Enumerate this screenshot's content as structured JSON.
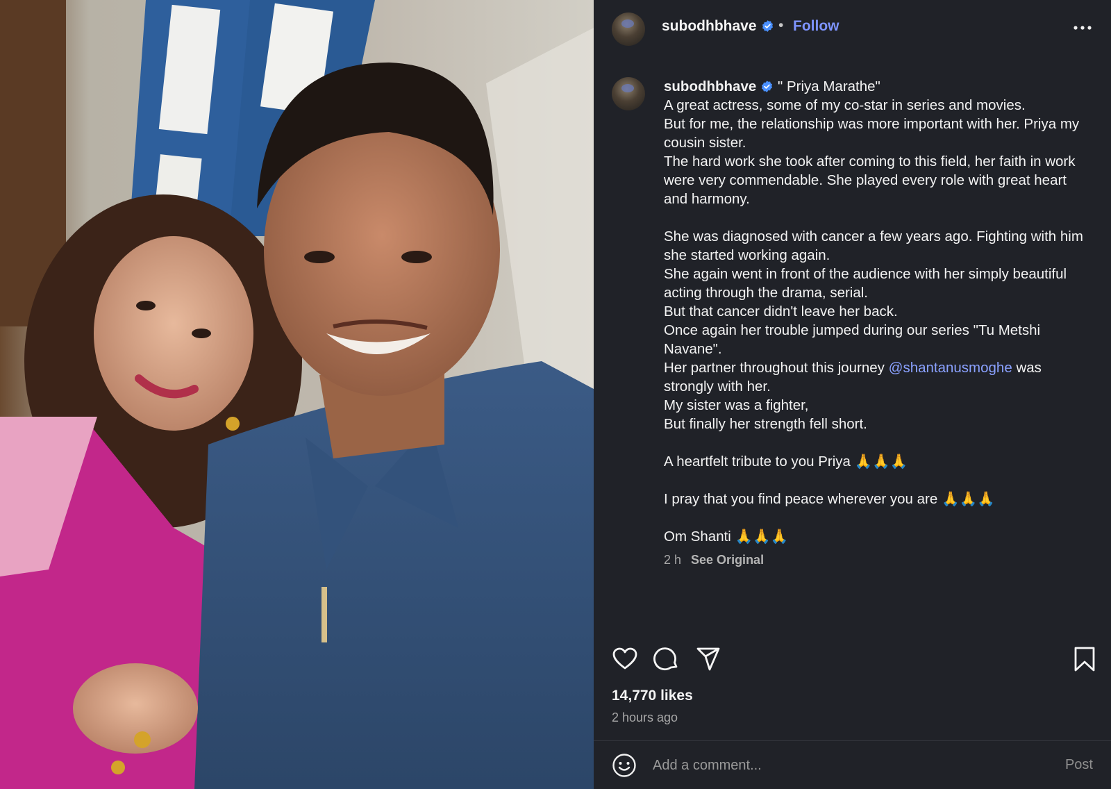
{
  "post": {
    "username": "subodhbhave",
    "verified": true,
    "follow_label": "Follow",
    "separator": "•",
    "more_icon": "more-horizontal-icon"
  },
  "caption": {
    "username": "subodhbhave",
    "lines": [
      "\" Priya Marathe\"",
      "A great actress, some of my co-star in series and movies.",
      "But for me, the relationship was more important with her. Priya my cousin sister.",
      "The hard work she took after coming to this field, her faith in work were very commendable. She played every role with great heart and harmony.",
      "",
      "She was diagnosed with cancer a few years ago. Fighting with him she started working again.",
      "She again went in front of the audience with her simply beautiful acting through the drama, serial.",
      "But that cancer didn't leave her back.",
      "Once again her trouble jumped during our series \"Tu Metshi Navane\".",
      "Her partner throughout this journey",
      "@shantanusmoghe",
      "was strongly with her.",
      "My sister was a fighter,",
      "But finally her strength fell short.",
      "",
      "A heartfelt tribute to you Priya 🙏🙏🙏",
      "",
      "I pray that you find peace wherever you are 🙏🙏🙏",
      "",
      "Om Shanti 🙏🙏🙏"
    ],
    "time": "2 h",
    "see_original": "See Original"
  },
  "actions": {
    "like_icon": "heart-icon",
    "comment_icon": "comment-icon",
    "share_icon": "share-icon",
    "save_icon": "bookmark-icon"
  },
  "likes": "14,770 likes",
  "posted_ago": "2 hours ago",
  "comment": {
    "emoji_icon": "emoji-icon",
    "placeholder": "Add a comment...",
    "post_label": "Post"
  },
  "colors": {
    "background": "#202228",
    "accent": "#7e94ff",
    "mention": "#8aa1ff",
    "verified": "#4a90ff"
  }
}
